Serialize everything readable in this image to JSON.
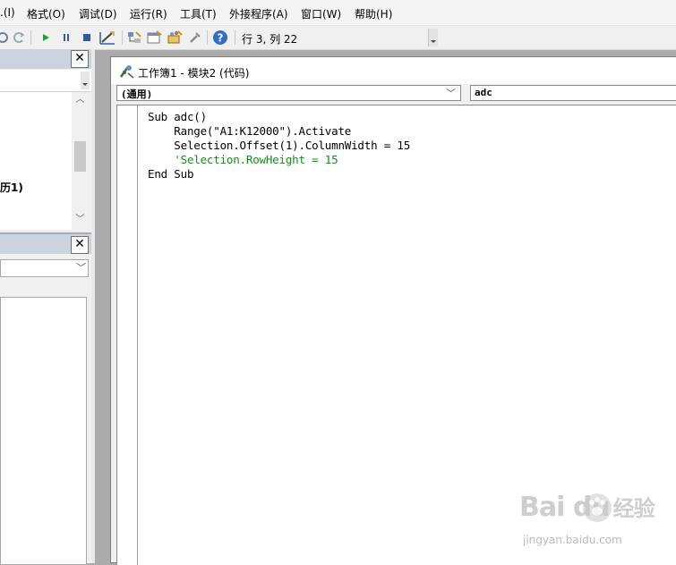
{
  "menu": {
    "items": [
      {
        "label": ".(I)"
      },
      {
        "label": "格式(O)"
      },
      {
        "label": "调试(D)"
      },
      {
        "label": "运行(R)"
      },
      {
        "label": "工具(T)"
      },
      {
        "label": "外接程序(A)"
      },
      {
        "label": "窗口(W)"
      },
      {
        "label": "帮助(H)"
      }
    ]
  },
  "toolbar": {
    "status": "行 3, 列 22",
    "icons": [
      "undo-icon",
      "redo-icon",
      "run-icon",
      "pause-icon",
      "stop-icon",
      "design-mode-icon",
      "project-explorer-icon",
      "properties-window-icon",
      "object-browser-icon",
      "toolbox-icon",
      "help-icon"
    ]
  },
  "left_panel": {
    "tree_label": "历1)"
  },
  "code_window": {
    "title": "工作簿1 - 模块2 (代码)",
    "object_combo": "(通用)",
    "proc_combo": "adc",
    "lines": [
      {
        "text": "Sub adc()"
      },
      {
        "text": "    Range(\"A1:K12000\").Activate"
      },
      {
        "text": "    Selection.Offset(1).ColumnWidth = 15"
      },
      {
        "text": "    'Selection.RowHeight = 15"
      },
      {
        "text": "End Sub"
      }
    ]
  },
  "watermark": {
    "brand": "Bai  du",
    "brand_cn": "经验",
    "url": "jingyan.baidu.com"
  },
  "colors": {
    "panel_title": "#cbd3df",
    "comment": "#1e8a1e",
    "background": "#ababab"
  }
}
